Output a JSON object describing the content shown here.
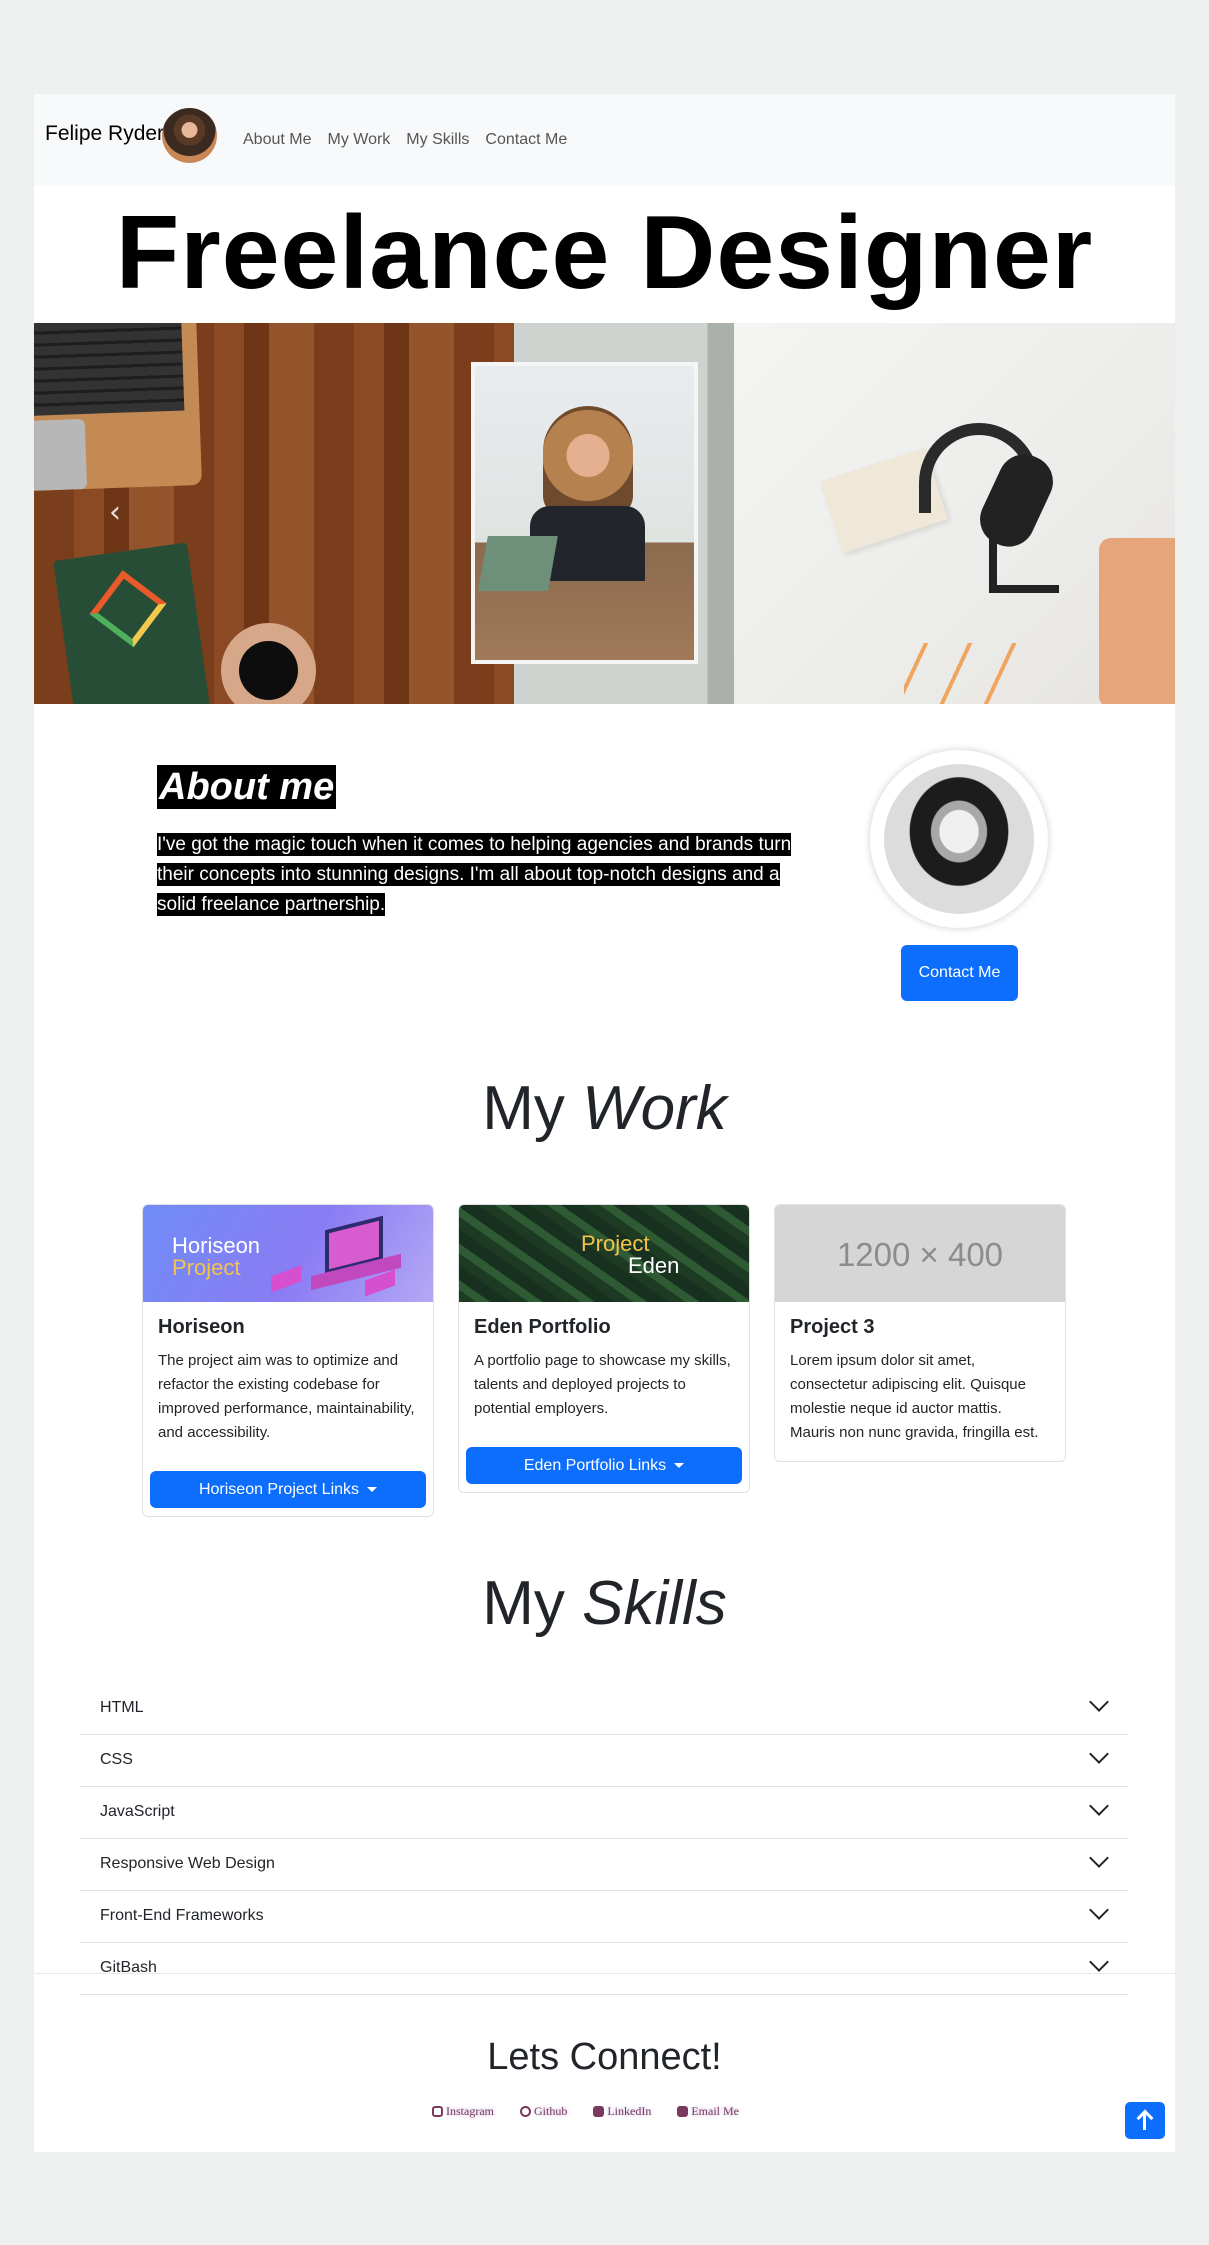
{
  "nav": {
    "brand": "Felipe Ryder",
    "links": [
      "About Me",
      "My Work",
      "My Skills",
      "Contact Me"
    ]
  },
  "hero": {
    "title": "Freelance Designer",
    "prev_icon": "chevron-left"
  },
  "about": {
    "title": "About me",
    "text": "I've got the magic touch when it comes to helping agencies and brands turn their concepts into stunning designs. I'm all about top-notch designs and a solid freelance partnership.",
    "contact_button": "Contact Me"
  },
  "work": {
    "title_prefix": "My",
    "title_emphasis": "Work",
    "cards": [
      {
        "image_label_line1": "Horiseon",
        "image_label_line2": "Project",
        "title": "Horiseon",
        "text": "The project aim was to optimize and refactor the existing codebase for improved performance, maintainability, and accessibility.",
        "button": "Horiseon Project Links"
      },
      {
        "image_label_line1": "Project",
        "image_label_line2": "Eden",
        "title": "Eden Portfolio",
        "text": "A portfolio page to showcase my skills, talents and deployed projects to potential employers.",
        "button": "Eden Portfolio Links"
      },
      {
        "image_label": "1200 × 400",
        "title": "Project 3",
        "text": "Lorem ipsum dolor sit amet, consectetur adipiscing elit. Quisque molestie neque id auctor mattis. Mauris non nunc gravida, fringilla est."
      }
    ]
  },
  "skills": {
    "title_prefix": "My",
    "title_emphasis": "Skills",
    "items": [
      "HTML",
      "CSS",
      "JavaScript",
      "Responsive Web Design",
      "Front-End Frameworks",
      "GitBash"
    ]
  },
  "footer": {
    "title": "Lets Connect!",
    "links": [
      "Instagram",
      "Github",
      "LinkedIn",
      "Email Me"
    ],
    "icons": [
      "instagram-icon",
      "github-icon",
      "linkedin-icon",
      "envelope-icon"
    ],
    "to_top_icon": "arrow-up-icon"
  },
  "colors": {
    "primary": "#0d6efd",
    "page_bg": "#eef0ef",
    "nav_bg": "#f8f9fa",
    "social_text": "#7a3a5e"
  }
}
